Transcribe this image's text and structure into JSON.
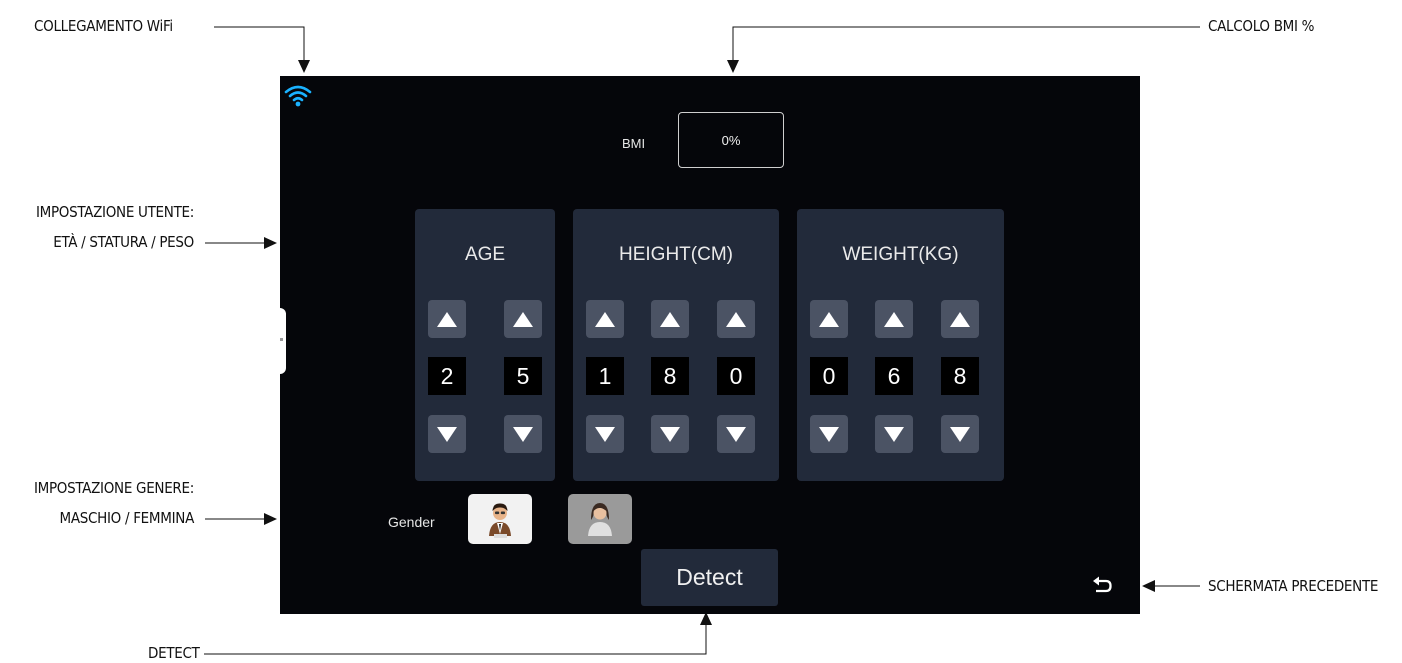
{
  "annotations": {
    "wifi": "COLLEGAMENTO WiFi",
    "bmi_calc": "CALCOLO BMI %",
    "user_settings_line1": "IMPOSTAZIONE UTENTE:",
    "user_settings_line2": "ETÀ / STATURA / PESO",
    "gender_settings_line1": "IMPOSTAZIONE GENERE:",
    "gender_settings_line2": "MASCHIO / FEMMINA",
    "back": "SCHERMATA PRECEDENTE",
    "detect": "DETECT"
  },
  "screen": {
    "bmi": {
      "label": "BMI",
      "value": "0%"
    },
    "panels": [
      {
        "title": "AGE",
        "digits": [
          "2",
          "5"
        ]
      },
      {
        "title": "HEIGHT(CM)",
        "digits": [
          "1",
          "8",
          "0"
        ]
      },
      {
        "title": "WEIGHT(KG)",
        "digits": [
          "0",
          "6",
          "8"
        ]
      }
    ],
    "gender": {
      "label": "Gender",
      "selected": "male"
    },
    "detect_label": "Detect"
  },
  "icons": {
    "wifi": "wifi-icon",
    "back": "return-arrow-icon",
    "male": "male-avatar-icon",
    "female": "female-avatar-icon",
    "up": "arrow-up-icon",
    "down": "arrow-down-icon"
  },
  "colors": {
    "screen_bg": "#05060a",
    "panel_bg": "#222a3a",
    "button_bg": "#4b5364",
    "wifi": "#1ab2ff"
  }
}
